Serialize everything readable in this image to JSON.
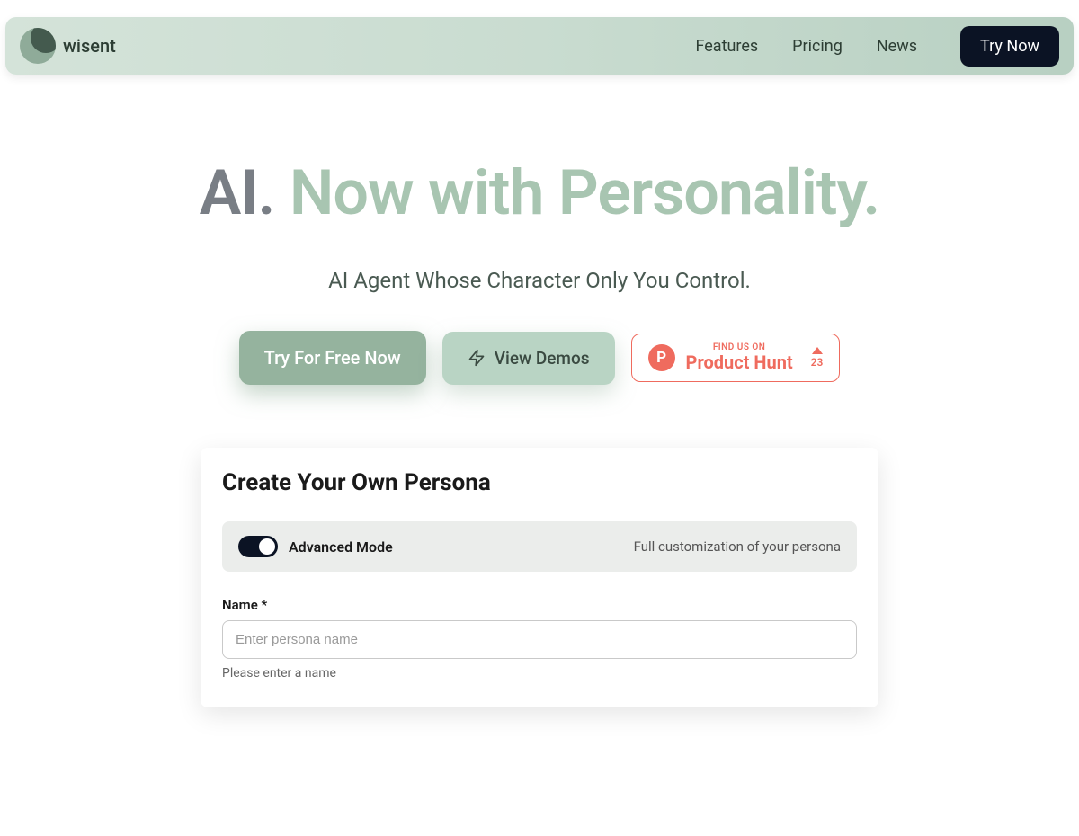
{
  "nav": {
    "brand": "wisent",
    "links": [
      "Features",
      "Pricing",
      "News"
    ],
    "tryNow": "Try Now"
  },
  "hero": {
    "titleDark": "AI.",
    "titleGreen": "Now with Personality.",
    "subtitle": "AI Agent Whose Character Only You Control."
  },
  "cta": {
    "primary": "Try For Free Now",
    "secondary": "View Demos",
    "ph": {
      "small": "FIND US ON",
      "big": "Product Hunt",
      "count": "23"
    }
  },
  "card": {
    "title": "Create Your Own Persona",
    "mode": {
      "label": "Advanced Mode",
      "desc": "Full customization of your persona"
    },
    "name": {
      "label": "Name *",
      "placeholder": "Enter persona name",
      "help": "Please enter a name"
    }
  }
}
